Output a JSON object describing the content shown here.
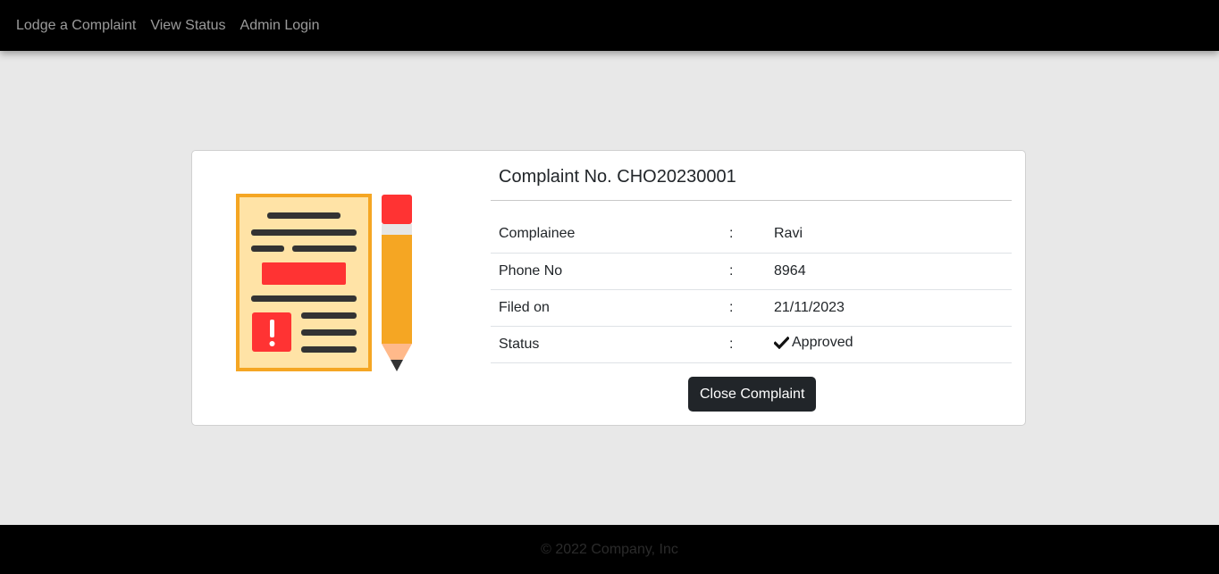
{
  "nav": {
    "items": [
      {
        "label": "Lodge a Complaint"
      },
      {
        "label": "View Status"
      },
      {
        "label": "Admin Login"
      }
    ]
  },
  "complaint": {
    "title": "Complaint No. CHO20230001",
    "rows": [
      {
        "label": "Complainee",
        "separator": ":",
        "value": "Ravi"
      },
      {
        "label": "Phone No",
        "separator": ":",
        "value": "8964"
      },
      {
        "label": "Filed on",
        "separator": ":",
        "value": "21/11/2023"
      },
      {
        "label": "Status",
        "separator": ":",
        "value": "Approved",
        "icon": "check-icon"
      }
    ],
    "close_button_label": "Close Complaint"
  },
  "illustration": {
    "icon": "document-with-pencil-icon"
  },
  "footer": {
    "text": "© 2022 Company, Inc"
  },
  "colors": {
    "navbar_bg": "#000000",
    "page_bg": "#e8e8e8",
    "button_bg": "#212529",
    "illustration_orange": "#f5a623",
    "illustration_red": "#ff3333"
  }
}
